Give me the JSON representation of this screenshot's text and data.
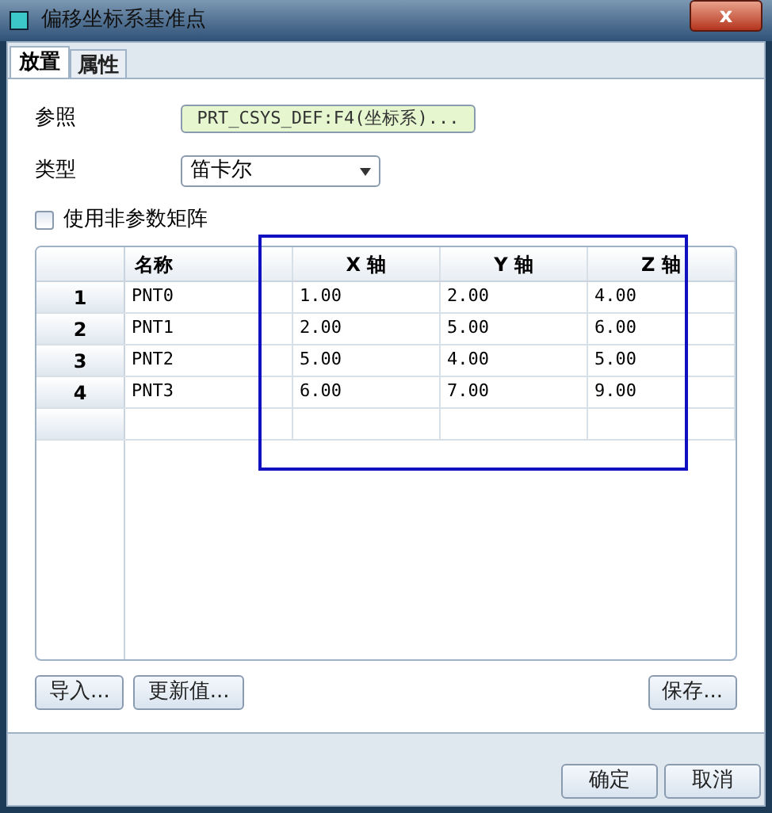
{
  "window": {
    "title": "偏移坐标系基准点",
    "close": "x"
  },
  "tabs": [
    {
      "label": "放置",
      "selected": true
    },
    {
      "label": "属性",
      "selected": false
    }
  ],
  "reference": {
    "label": "参照",
    "value": "PRT_CSYS_DEF:F4(坐标系)..."
  },
  "type": {
    "label": "类型",
    "value": "笛卡尔"
  },
  "nonparametric": {
    "label": "使用非参数矩阵",
    "checked": false
  },
  "table": {
    "columns": [
      "名称",
      "X 轴",
      "Y 轴",
      "Z 轴"
    ],
    "rows": [
      {
        "index": "1",
        "cells": [
          "PNT0",
          "1.00",
          "2.00",
          "4.00"
        ]
      },
      {
        "index": "2",
        "cells": [
          "PNT1",
          "2.00",
          "5.00",
          "6.00"
        ]
      },
      {
        "index": "3",
        "cells": [
          "PNT2",
          "5.00",
          "4.00",
          "5.00"
        ]
      },
      {
        "index": "4",
        "cells": [
          "PNT3",
          "6.00",
          "7.00",
          "9.00"
        ]
      }
    ]
  },
  "table_buttons": [
    "导入...",
    "更新值..."
  ],
  "save_button": "保存...",
  "footer_buttons": [
    "确定",
    "取消"
  ]
}
